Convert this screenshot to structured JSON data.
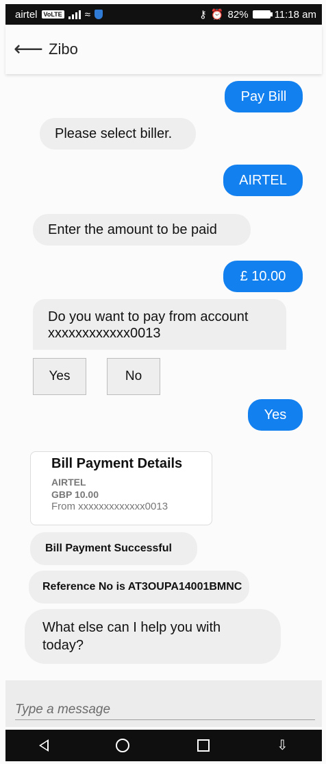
{
  "status_bar": {
    "carrier": "airtel",
    "volte": "VoLTE",
    "right": "82%",
    "time": "11:18 am"
  },
  "app_bar": {
    "title": "Zibo"
  },
  "chat": {
    "pay_bill": "Pay Bill",
    "select_biller": "Please select biller.",
    "airtel": "AIRTEL",
    "enter_amount": "Enter the amount to be paid",
    "amount": "£ 10.00",
    "question": "Do you want to pay from account xxxxxxxxxxxx0013",
    "yes_button": "Yes",
    "no_button": "No",
    "yes_reply": "Yes",
    "card": {
      "title": "Bill Payment Details",
      "biller": "AIRTEL",
      "amount": "GBP 10.00",
      "from": "From xxxxxxxxxxxxx0013"
    },
    "success": "Bill Payment Successful",
    "reference": "Reference No is AT3OUPA14001BMNC",
    "followup": "What else can I help you with today?"
  },
  "input": {
    "placeholder": "Type a message"
  },
  "colors": {
    "accent": "#1380f0",
    "bot_bubble": "#eeeeee"
  }
}
